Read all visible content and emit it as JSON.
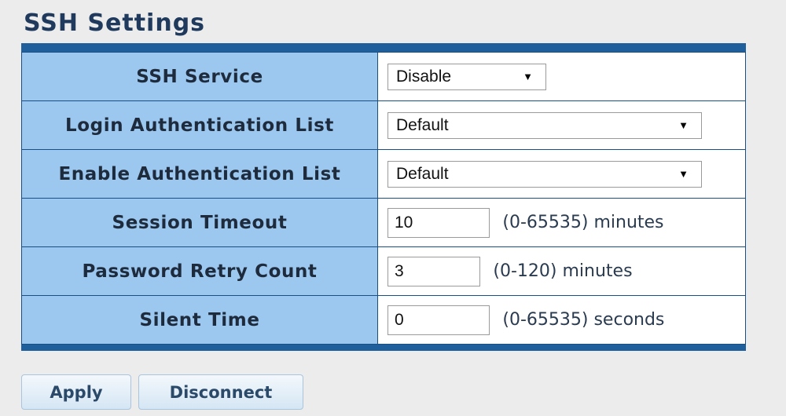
{
  "title": "SSH Settings",
  "fields": {
    "ssh_service": {
      "label": "SSH Service",
      "value": "Disable"
    },
    "login_auth_list": {
      "label": "Login Authentication List",
      "value": "Default"
    },
    "enable_auth_list": {
      "label": "Enable Authentication List",
      "value": "Default"
    },
    "session_timeout": {
      "label": "Session Timeout",
      "value": "10",
      "hint": "(0-65535) minutes"
    },
    "password_retry": {
      "label": "Password Retry Count",
      "value": "3",
      "hint": "(0-120) minutes"
    },
    "silent_time": {
      "label": "Silent Time",
      "value": "0",
      "hint": "(0-65535) seconds"
    }
  },
  "buttons": {
    "apply": "Apply",
    "disconnect": "Disconnect"
  },
  "icons": {
    "dropdown": "caret-down-icon"
  },
  "colors": {
    "title": "#1f3a5c",
    "table_frame": "#1f5f9c",
    "label_bg": "#9cc8ef",
    "button_text": "#2b4a6a"
  }
}
